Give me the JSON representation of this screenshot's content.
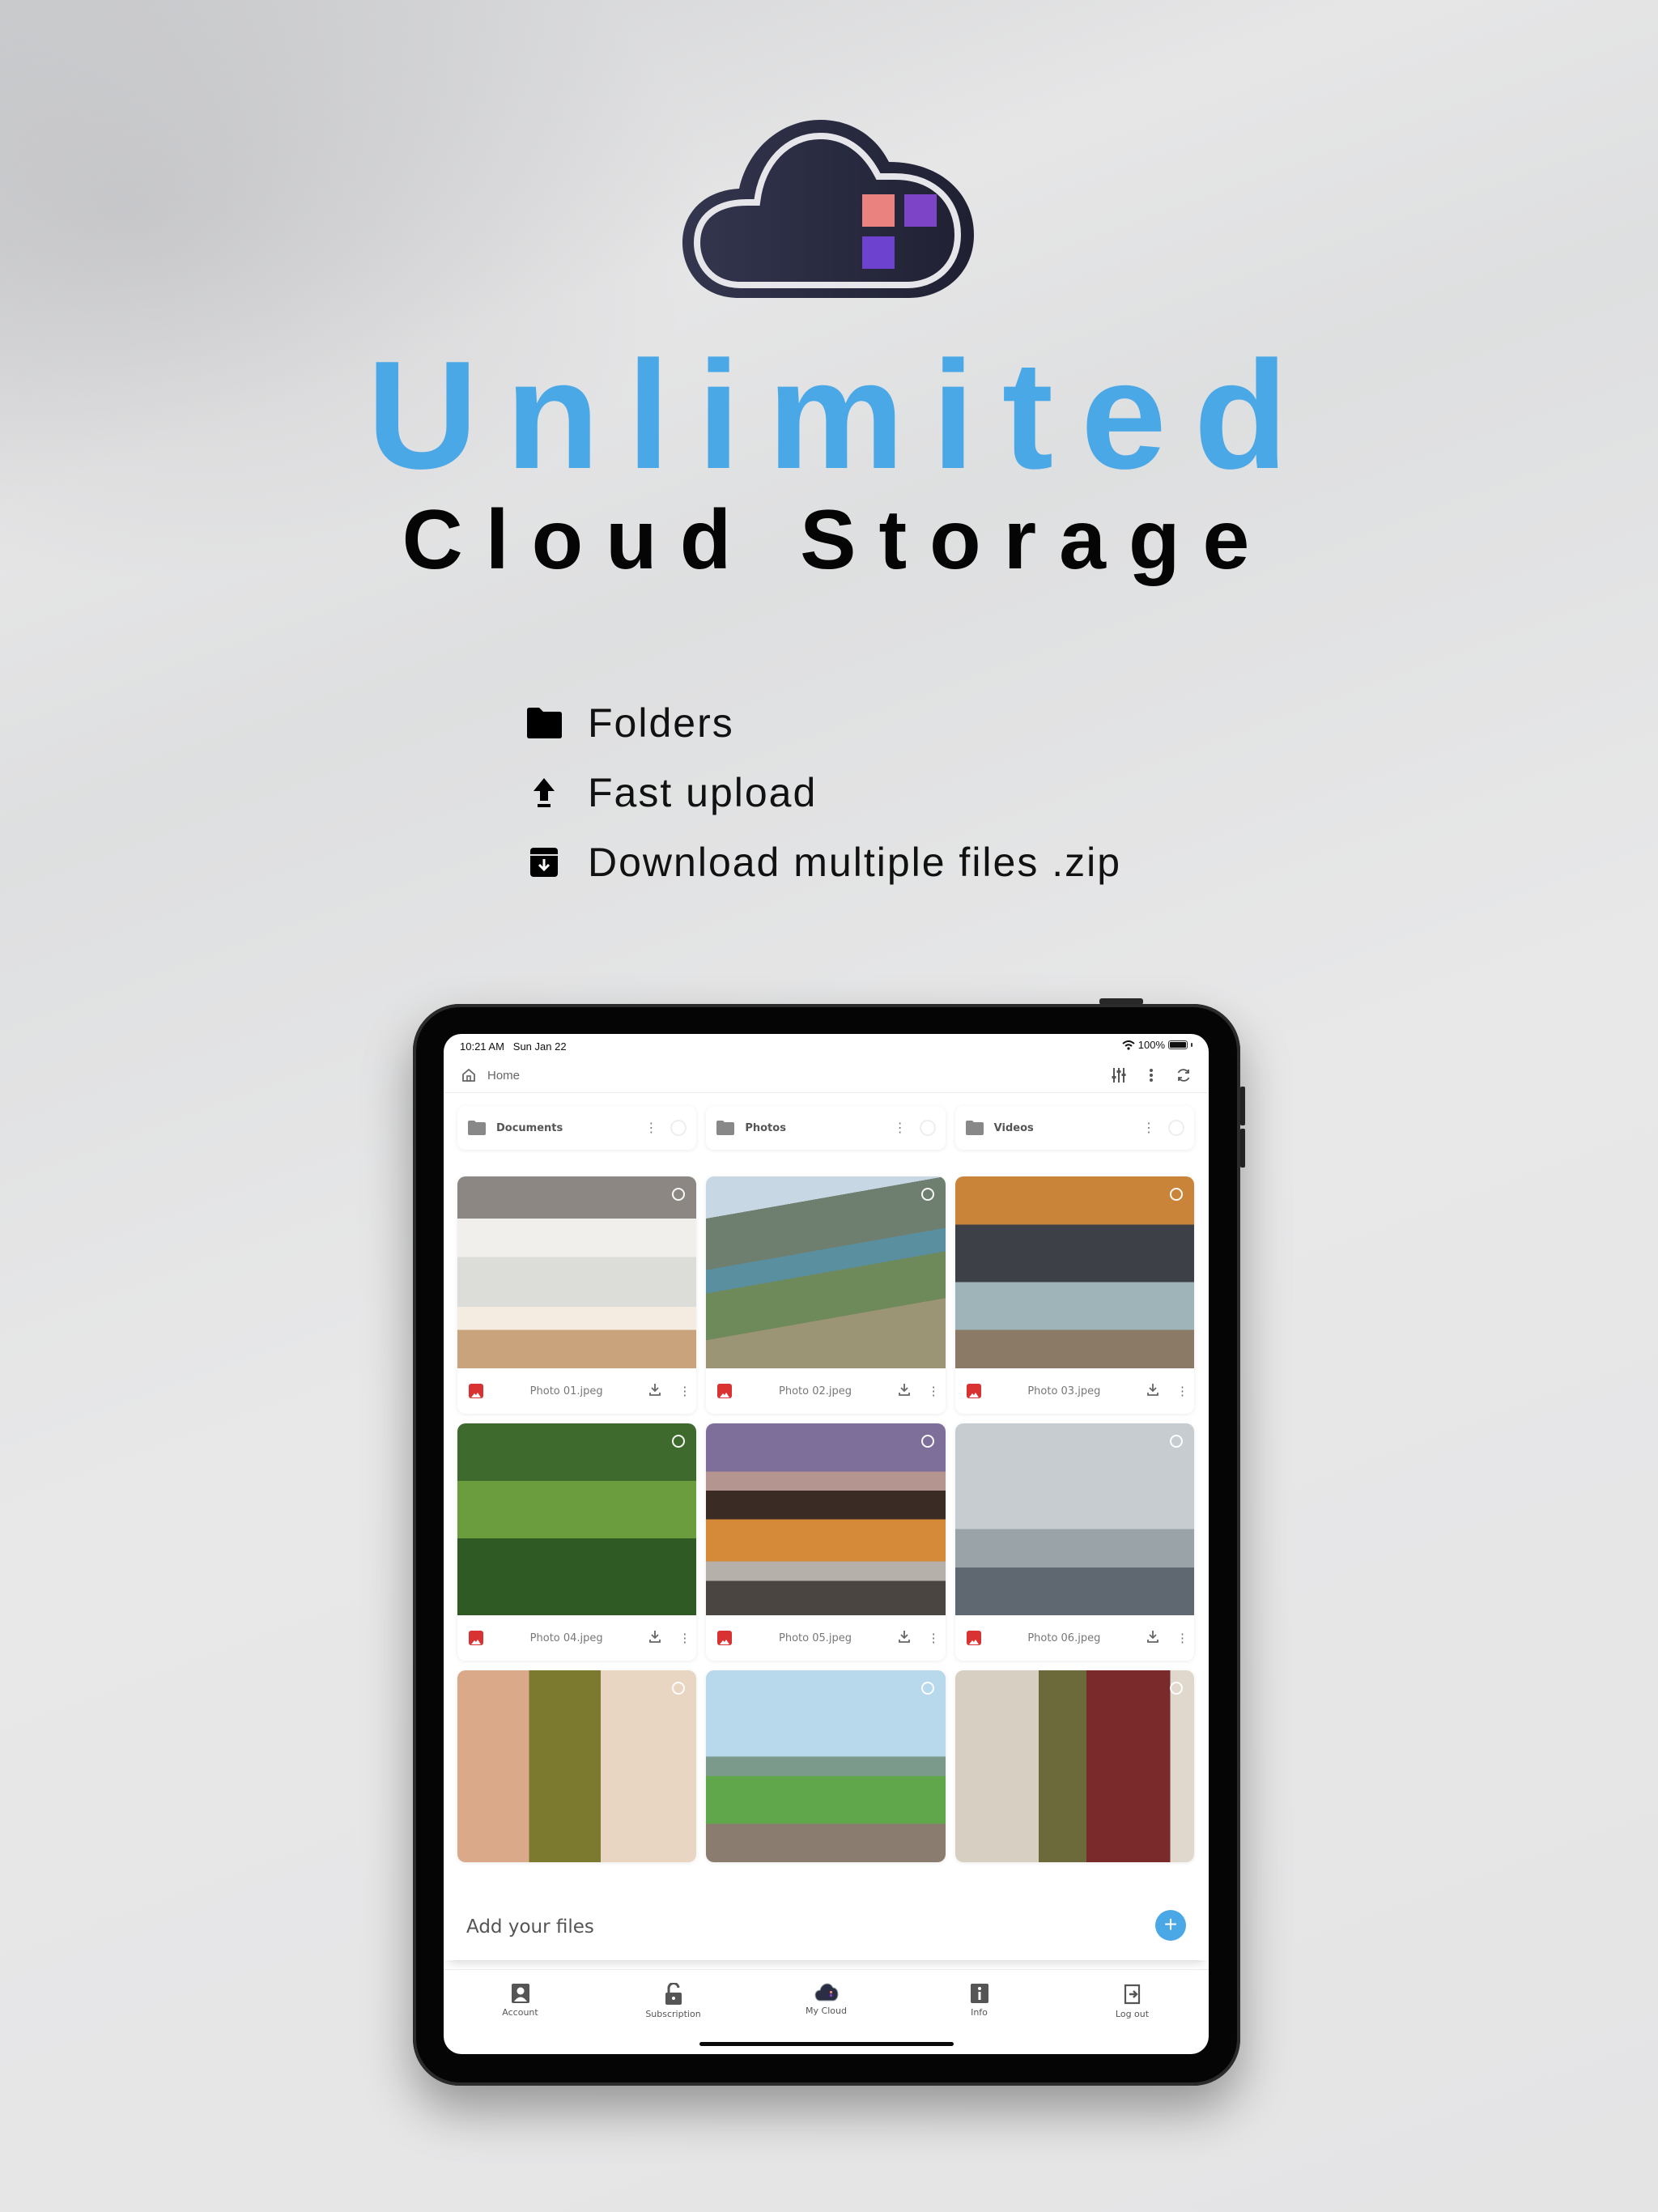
{
  "promo": {
    "headline": "Unlimited",
    "subheadline": "Cloud Storage",
    "logo_colors": {
      "cloud": "#2b2d44",
      "outline": "#e6e6ea",
      "square_1": "#ea8380",
      "square_2": "#7e44c8",
      "square_3": "#6d42cf"
    },
    "accent_color": "#4aa8e6",
    "features": [
      {
        "icon": "folder-icon",
        "label": "Folders"
      },
      {
        "icon": "upload-icon",
        "label": "Fast upload"
      },
      {
        "icon": "archive-download-icon",
        "label": "Download multiple files .zip"
      }
    ]
  },
  "device": {
    "status_bar": {
      "time": "10:21 AM",
      "date": "Sun Jan 22",
      "battery": "100%"
    },
    "topbar": {
      "breadcrumb": "Home",
      "actions": [
        "sort-filter-icon",
        "more-vertical-icon",
        "refresh-icon"
      ]
    },
    "folders": [
      {
        "name": "Documents"
      },
      {
        "name": "Photos"
      },
      {
        "name": "Videos"
      }
    ],
    "files": [
      {
        "name": "Photo 01.jpeg",
        "type": "image"
      },
      {
        "name": "Photo 02.jpeg",
        "type": "image"
      },
      {
        "name": "Photo 03.jpeg",
        "type": "image"
      },
      {
        "name": "Photo 04.jpeg",
        "type": "image"
      },
      {
        "name": "Photo 05.jpeg",
        "type": "image"
      },
      {
        "name": "Photo 06.jpeg",
        "type": "image"
      },
      {
        "name": "",
        "type": "image"
      },
      {
        "name": "",
        "type": "image"
      },
      {
        "name": "",
        "type": "image"
      }
    ],
    "add_bar": {
      "label": "Add your files",
      "button": "+"
    },
    "tabs": [
      {
        "label": "Account",
        "icon": "account-icon"
      },
      {
        "label": "Subscription",
        "icon": "unlock-icon"
      },
      {
        "label": "My Cloud",
        "icon": "cloud-logo-icon",
        "active": true
      },
      {
        "label": "Info",
        "icon": "info-icon"
      },
      {
        "label": "Log out",
        "icon": "logout-icon"
      }
    ]
  }
}
